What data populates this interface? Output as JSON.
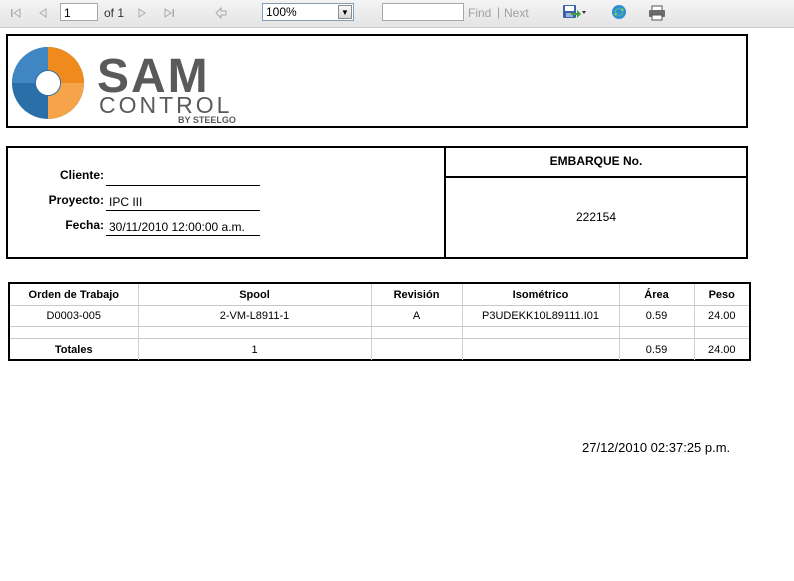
{
  "toolbar": {
    "page_current": "1",
    "page_of": "of 1",
    "zoom": "100%",
    "find_placeholder": "",
    "find_label": "Find",
    "separator": "|",
    "next_label": "Next",
    "icons": [
      "first-page-icon",
      "prev-page-icon",
      "next-page-icon",
      "last-page-icon",
      "back-icon",
      "export-icon",
      "refresh-icon",
      "print-icon"
    ]
  },
  "logo": {
    "text_main": "SAM",
    "text_sub": "CONTROL",
    "text_by": "BY STEELGO",
    "colors": {
      "orange": "#f08a1c",
      "blue": "#2b6fa8",
      "text": "#555555"
    }
  },
  "info": {
    "cliente_label": "Cliente:",
    "cliente_value": "",
    "proyecto_label": "Proyecto:",
    "proyecto_value": "IPC III",
    "fecha_label": "Fecha:",
    "fecha_value": "30/11/2010 12:00:00 a.m.",
    "embarque_label": "EMBARQUE No.",
    "embarque_value": "222154"
  },
  "table": {
    "headers": [
      "Orden de Trabajo",
      "Spool",
      "Revisión",
      "Isométrico",
      "Área",
      "Peso"
    ],
    "rows": [
      [
        "D0003-005",
        "2-VM-L8911-1",
        "A",
        "P3UDEKK10L89111.I01",
        "0.59",
        "24.00"
      ]
    ],
    "totals": [
      "Totales",
      "1",
      "",
      "",
      "0.59",
      "24.00"
    ]
  },
  "timestamp": "27/12/2010 02:37:25 p.m."
}
